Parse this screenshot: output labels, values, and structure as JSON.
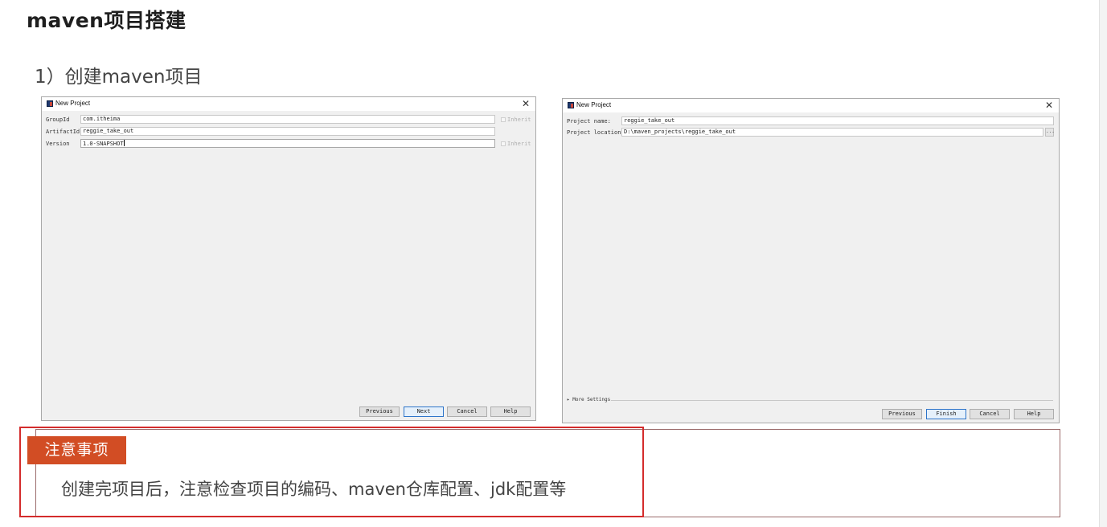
{
  "page": {
    "title": "maven项目搭建",
    "step": "1）创建maven项目"
  },
  "dialog_left": {
    "title": "New Project",
    "close": "✕",
    "fields": {
      "group_label": "GroupId",
      "group_value": "com.itheima",
      "artifact_label": "ArtifactId",
      "artifact_value": "reggie_take_out",
      "version_label": "Version",
      "version_value": "1.0-SNAPSHOT"
    },
    "inherit_label": "Inherit",
    "buttons": {
      "previous": "Previous",
      "next": "Next",
      "cancel": "Cancel",
      "help": "Help"
    }
  },
  "dialog_right": {
    "title": "New Project",
    "close": "✕",
    "fields": {
      "name_label": "Project name:",
      "name_value": "reggie_take_out",
      "location_label": "Project location:",
      "location_value": "D:\\maven_projects\\reggie_take_out"
    },
    "browse": "...",
    "more_settings": "▸ More Settings",
    "buttons": {
      "previous": "Previous",
      "finish": "Finish",
      "cancel": "Cancel",
      "help": "Help"
    }
  },
  "note": {
    "badge": "注意事项",
    "text": "创建完项目后，注意检查项目的编码、maven仓库配置、jdk配置等"
  },
  "colors": {
    "badge_bg": "#d24d24",
    "highlight_border": "#d42c2c",
    "primary_button_border": "#2d74c9"
  }
}
